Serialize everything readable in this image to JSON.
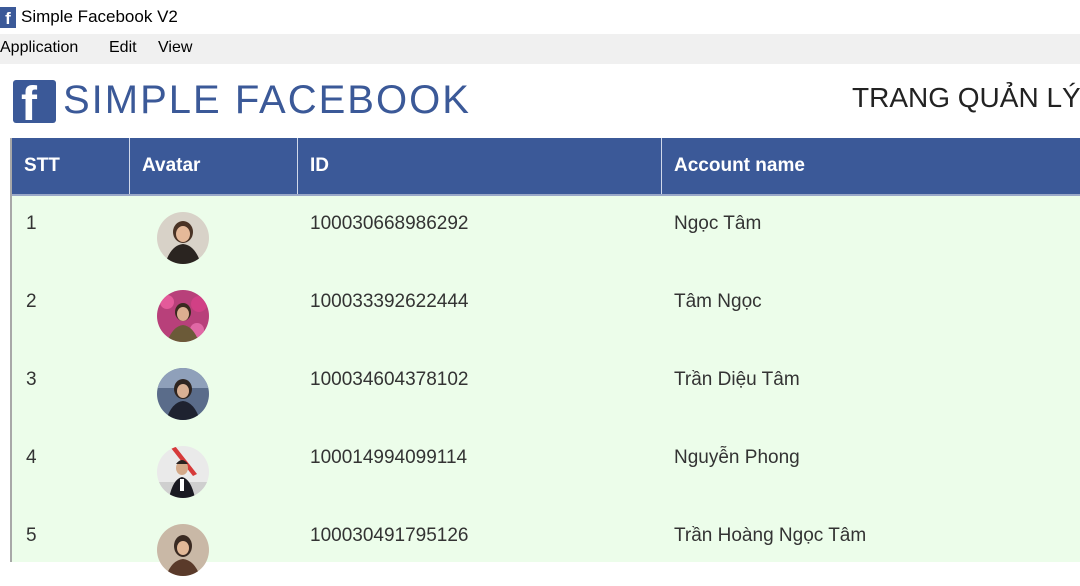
{
  "window": {
    "title": "Simple Facebook V2",
    "icon": "facebook-icon"
  },
  "menu": [
    "Application",
    "Edit",
    "View"
  ],
  "header": {
    "logo_glyph": "f",
    "logo_text": "SIMPLE FACEBOOK",
    "page_title": "TRANG QUẢN LÝ"
  },
  "table": {
    "columns": [
      "STT",
      "Avatar",
      "ID",
      "Account name"
    ],
    "rows": [
      {
        "stt": "1",
        "id": "100030668986292",
        "name": "Ngọc Tâm",
        "avatar": "avatar-photo-icon"
      },
      {
        "stt": "2",
        "id": "100033392622444",
        "name": "Tâm Ngọc",
        "avatar": "avatar-photo-icon"
      },
      {
        "stt": "3",
        "id": "100034604378102",
        "name": "Trần Diệu Tâm",
        "avatar": "avatar-photo-icon"
      },
      {
        "stt": "4",
        "id": "100014994099114",
        "name": "Nguyễn Phong",
        "avatar": "avatar-photo-icon"
      },
      {
        "stt": "5",
        "id": "100030491795126",
        "name": "Trần Hoàng Ngọc Tâm",
        "avatar": "avatar-photo-icon"
      }
    ]
  },
  "colors": {
    "brand": "#3b5998",
    "row_bg": "#ecfdea",
    "menubar_bg": "#f0f0f0"
  }
}
